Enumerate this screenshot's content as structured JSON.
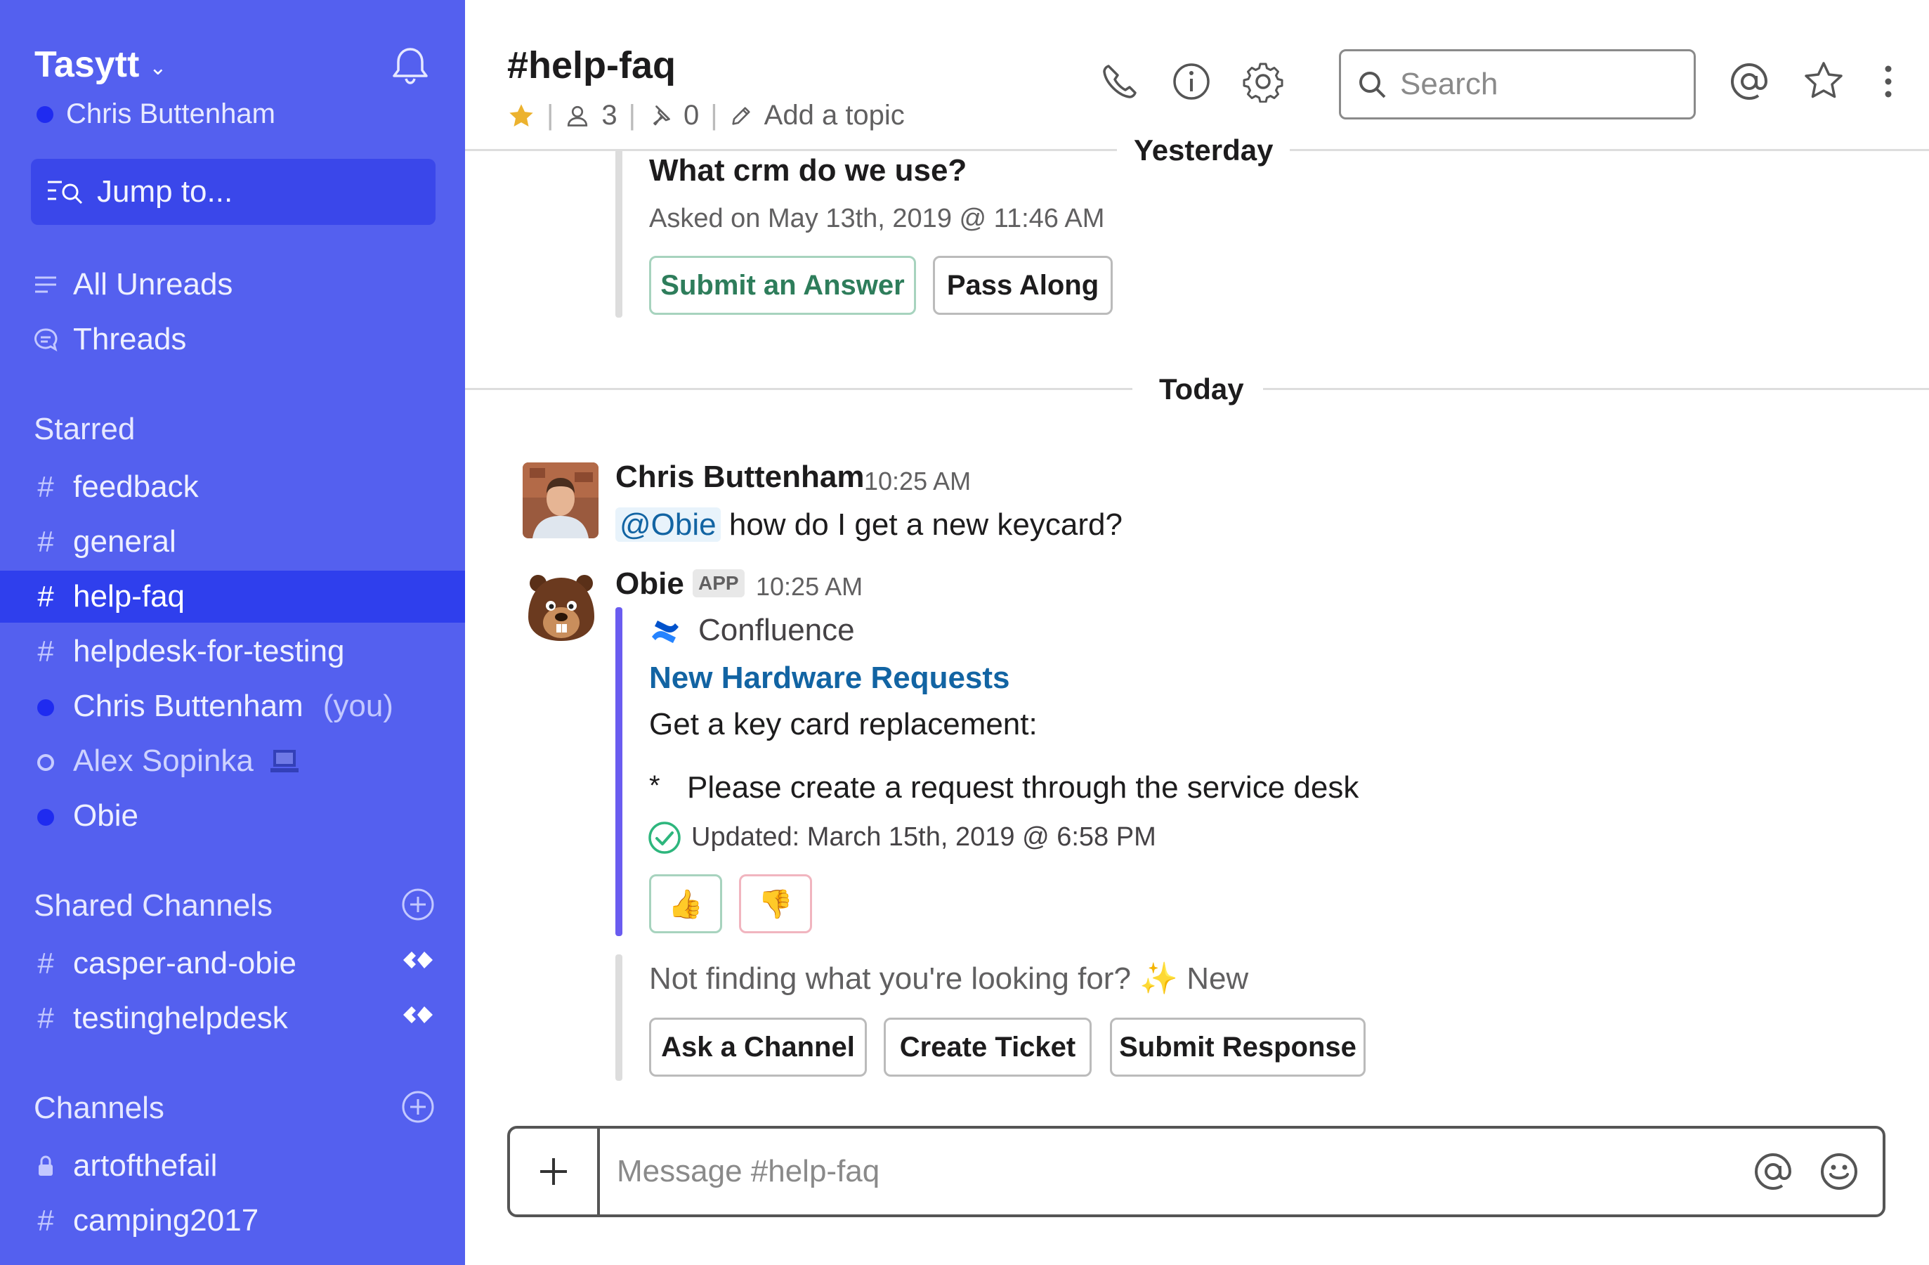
{
  "colors": {
    "sidebar": "#5460ef",
    "sidebar_active": "#2f3fed",
    "link": "#1264a3",
    "green": "#2e7d5b",
    "bot_bar": "#6a5cf0"
  },
  "sidebar": {
    "team_name": "Tasytt",
    "user_name": "Chris Buttenham",
    "jump_label": "Jump to...",
    "nav": {
      "all_unreads": "All Unreads",
      "threads": "Threads"
    },
    "starred_title": "Starred",
    "starred": [
      {
        "prefix": "#",
        "label": "feedback"
      },
      {
        "prefix": "#",
        "label": "general"
      },
      {
        "prefix": "#",
        "label": "help-faq",
        "active": true
      },
      {
        "prefix": "#",
        "label": "helpdesk-for-testing"
      },
      {
        "label": "Chris Buttenham",
        "suffix": "(you)",
        "presence": "online"
      },
      {
        "label": "Alex Sopinka",
        "presence": "away"
      },
      {
        "label": "Obie",
        "presence": "online"
      }
    ],
    "shared_title": "Shared Channels",
    "shared": [
      {
        "prefix": "#",
        "label": "casper-and-obie"
      },
      {
        "prefix": "#",
        "label": "testinghelpdesk"
      }
    ],
    "channels_title": "Channels",
    "channels": [
      {
        "prefix": "lock",
        "label": "artofthefail"
      },
      {
        "prefix": "#",
        "label": "camping2017"
      }
    ]
  },
  "header": {
    "channel": "#help-faq",
    "members": "3",
    "pins": "0",
    "add_topic": "Add a topic",
    "search_placeholder": "Search"
  },
  "messages": {
    "yesterday_label": "Yesterday",
    "today_label": "Today",
    "question": {
      "title": "What crm do we use?",
      "asked": "Asked on May 13th, 2019 @ 11:46 AM",
      "submit_answer": "Submit an Answer",
      "pass_along": "Pass Along"
    },
    "chris": {
      "name": "Chris Buttenham",
      "time": "10:25 AM",
      "mention": "@Obie",
      "text": "how do I get a new keycard?"
    },
    "obie": {
      "name": "Obie",
      "badge": "APP",
      "time": "10:25 AM",
      "source": "Confluence",
      "link_title": "New Hardware Requests",
      "body": "Get a key card replacement:",
      "bullet_marker": "*",
      "bullet": "Please create a request through the service desk",
      "updated": "Updated: March 15th, 2019 @ 6:58 PM",
      "not_finding": "Not finding what you're looking for?",
      "sparkle": "✨",
      "new_label": "New",
      "ask_channel": "Ask a Channel",
      "create_ticket": "Create Ticket",
      "submit_response": "Submit Response"
    }
  },
  "composer": {
    "placeholder": "Message #help-faq"
  }
}
